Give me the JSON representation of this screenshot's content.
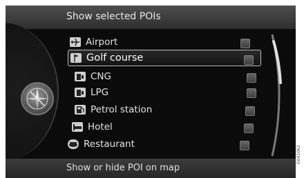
{
  "header": {
    "title": "Show selected POIs"
  },
  "poi_items": [
    {
      "label": "Airport",
      "icon": "airplane-icon",
      "checked": false
    },
    {
      "label": "Golf course",
      "icon": "golf-flag-icon",
      "checked": false,
      "selected": true
    },
    {
      "label": "CNG",
      "icon": "cng-pump-icon",
      "checked": false
    },
    {
      "label": "LPG",
      "icon": "lpg-pump-icon",
      "checked": false
    },
    {
      "label": "Petrol station",
      "icon": "fuel-pump-icon",
      "checked": false
    },
    {
      "label": "Hotel",
      "icon": "bed-icon",
      "checked": false
    },
    {
      "label": "Restaurant",
      "icon": "restaurant-icon",
      "checked": false
    }
  ],
  "footer": {
    "text": "Show or hide POI on map"
  },
  "side_code": "G041062"
}
